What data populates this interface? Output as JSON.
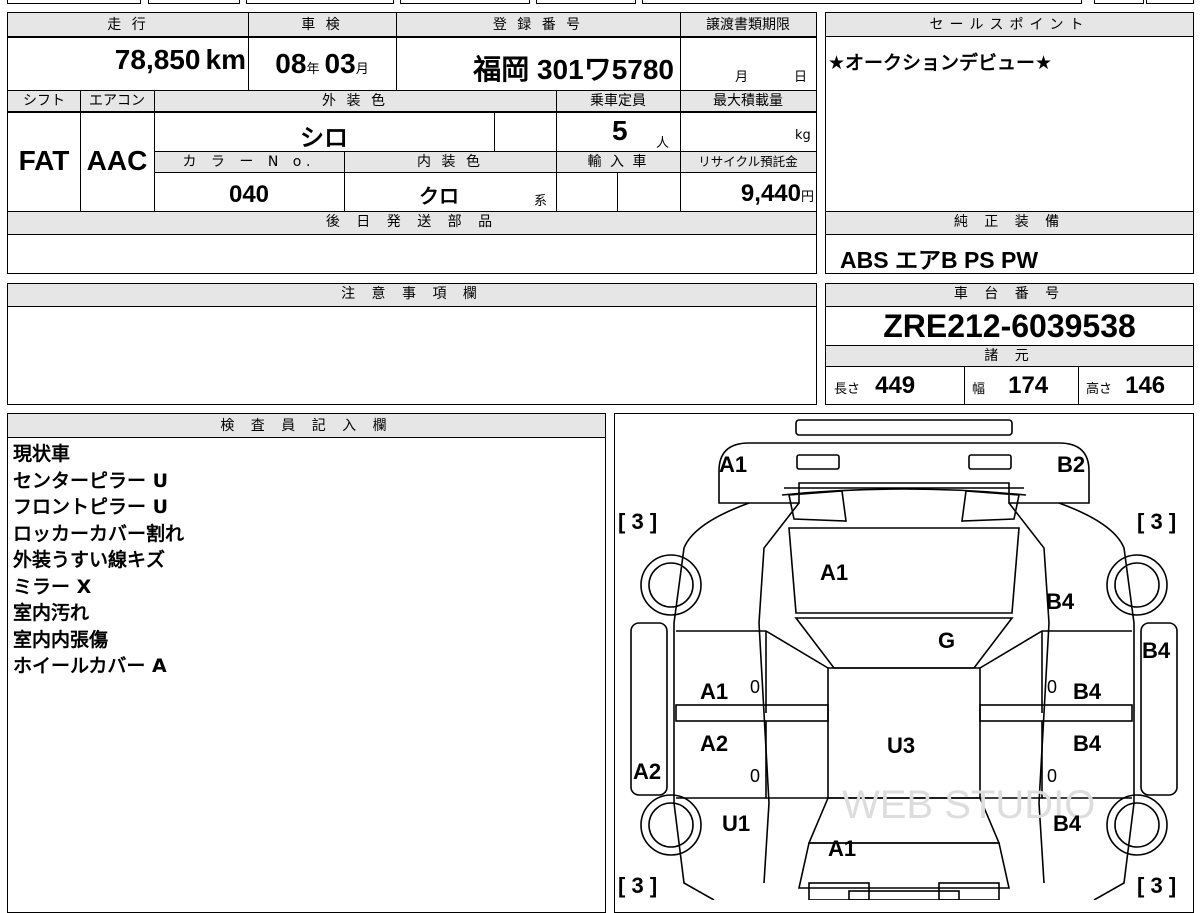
{
  "header_labels": {
    "mileage": "走 行",
    "shaken": "車 検",
    "registration": "登 録 番 号",
    "transfer_deadline": "譲渡書類期限",
    "sales_point": "セールスポイント",
    "shift": "シフト",
    "aircon": "エアコン",
    "exterior_color": "外 装 色",
    "capacity": "乗車定員",
    "max_load": "最大積載量",
    "color_no": "カ ラ ー N o.",
    "interior_color": "内 装 色",
    "import": "輸 入 車",
    "recycle": "リサイクル預託金",
    "later_parts": "後 日 発 送 部 品",
    "genuine_equipment": "純 正 装 備",
    "notes": "注 意 事 項 欄",
    "chassis_no": "車 台 番 号",
    "specs": "諸 元",
    "inspector": "検 査 員 記 入 欄"
  },
  "vehicle": {
    "mileage_value": "78,850",
    "mileage_unit": "km",
    "shaken_year": "08",
    "shaken_year_unit": "年",
    "shaken_month": "03",
    "shaken_month_unit": "月",
    "registration_number": "福岡 301ワ5780",
    "transfer_month_unit": "月",
    "transfer_day_unit": "日",
    "shift": "FAT",
    "aircon": "AAC",
    "exterior_color": "シロ",
    "capacity": "5",
    "capacity_unit": "人",
    "max_load_unit": "kg",
    "color_no": "040",
    "interior_color": "クロ",
    "interior_suffix": "系",
    "recycle_fee": "9,440",
    "recycle_unit": "円",
    "sales_point": "★オークションデビュー★",
    "genuine_equipment": "ABS エアB PS PW",
    "chassis_no": "ZRE212-6039538",
    "length_label": "長さ",
    "length": "449",
    "width_label": "幅",
    "width": "174",
    "height_label": "高さ",
    "height": "146"
  },
  "inspector_notes": [
    "現状車",
    "センターピラー U",
    "フロントピラー U",
    "ロッカーカバー割れ",
    "外装うすい線キズ",
    "ミラー X",
    "室内汚れ",
    "室内内張傷",
    "ホイールカバー A"
  ],
  "diagram": {
    "marks": {
      "front_left": "A1",
      "front_right": "B2",
      "hood": "A1",
      "front_fender_right": "B4",
      "windshield": "G",
      "right_side_panel": "B4",
      "front_door_left": "A1",
      "front_door_right": "B4",
      "rear_door_left": "A2",
      "rear_door_right": "B4",
      "roof": "U3",
      "left_rocker": "A2",
      "rear_fender_left": "U1",
      "rear_fender_right": "B4",
      "rear": "A1"
    },
    "zeros": [
      "0",
      "0",
      "0",
      "0"
    ],
    "tire_tread": [
      "3",
      "3",
      "3",
      "3"
    ],
    "bracket_open": "[",
    "bracket_close": "]"
  },
  "watermark": "WEB STUDIO"
}
